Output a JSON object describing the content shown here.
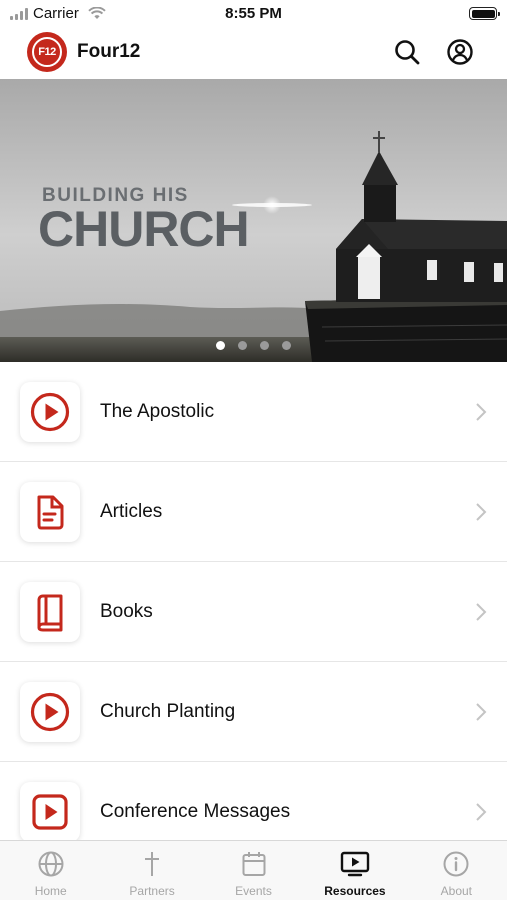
{
  "status_bar": {
    "carrier": "Carrier",
    "time": "8:55 PM"
  },
  "header": {
    "logo_text": "F12",
    "title": "Four12",
    "search_icon": "search-icon",
    "account_icon": "account-icon"
  },
  "banner": {
    "subtitle": "BUILDING HIS",
    "title": "CHURCH",
    "slide_count": 4,
    "active_slide": 1
  },
  "resources": [
    {
      "label": "The Apostolic",
      "icon": "play-circle-icon"
    },
    {
      "label": "Articles",
      "icon": "document-icon"
    },
    {
      "label": "Books",
      "icon": "book-icon"
    },
    {
      "label": "Church Planting",
      "icon": "play-circle-icon"
    },
    {
      "label": "Conference Messages",
      "icon": "video-icon"
    }
  ],
  "tabs": [
    {
      "label": "Home",
      "icon": "globe-icon",
      "active": false
    },
    {
      "label": "Partners",
      "icon": "cross-icon",
      "active": false
    },
    {
      "label": "Events",
      "icon": "calendar-icon",
      "active": false
    },
    {
      "label": "Resources",
      "icon": "tv-icon",
      "active": true
    },
    {
      "label": "About",
      "icon": "info-icon",
      "active": false
    }
  ],
  "colors": {
    "accent": "#c4281c",
    "inactive_tab": "#a6a6a6",
    "active_tab": "#111111"
  }
}
